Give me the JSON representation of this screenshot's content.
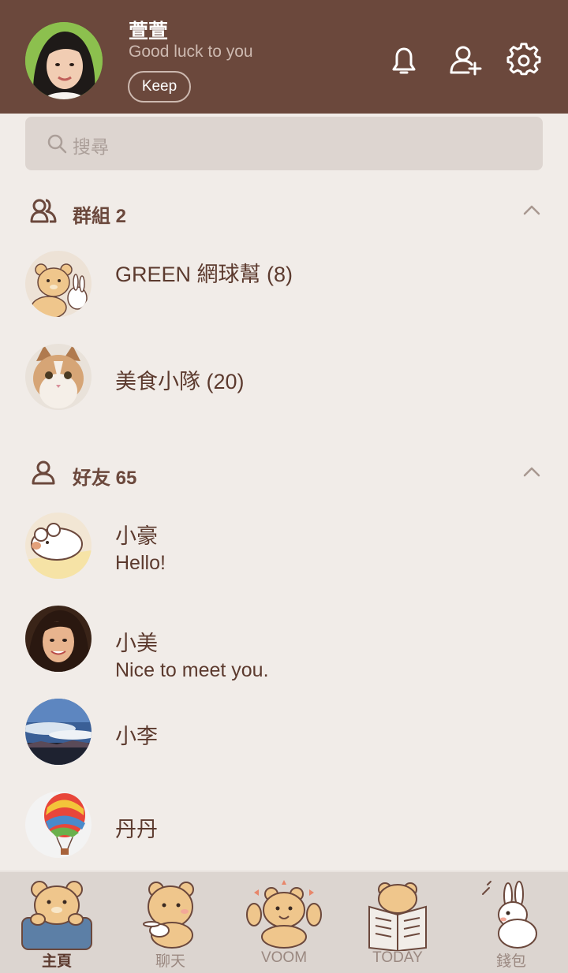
{
  "profile": {
    "name": "萱萱",
    "status": "Good luck to you",
    "keep_label": "Keep"
  },
  "search": {
    "placeholder": "搜尋"
  },
  "groups": {
    "label": "群組 2",
    "items": [
      {
        "name": "GREEN 網球幫 (8)"
      },
      {
        "name": "美食小隊 (20)"
      }
    ]
  },
  "friends": {
    "label": "好友 65",
    "items": [
      {
        "name": "小豪",
        "status": "Hello!"
      },
      {
        "name": "小美",
        "status": "Nice to meet you."
      },
      {
        "name": "小李",
        "status": ""
      },
      {
        "name": "丹丹",
        "status": ""
      }
    ]
  },
  "tabs": [
    {
      "label": "主頁",
      "icon": "bear-home-icon",
      "active": true
    },
    {
      "label": "聊天",
      "icon": "bear-chat-icon",
      "active": false
    },
    {
      "label": "VOOM",
      "icon": "bear-voom-icon",
      "active": false
    },
    {
      "label": "TODAY",
      "icon": "bear-newspaper-icon",
      "active": false
    },
    {
      "label": "錢包",
      "icon": "rabbit-wallet-icon",
      "active": false
    }
  ],
  "colors": {
    "header": "#6b483c",
    "background": "#f1ece8",
    "text": "#5c3a2e",
    "tabbar": "#dcd5d0"
  }
}
